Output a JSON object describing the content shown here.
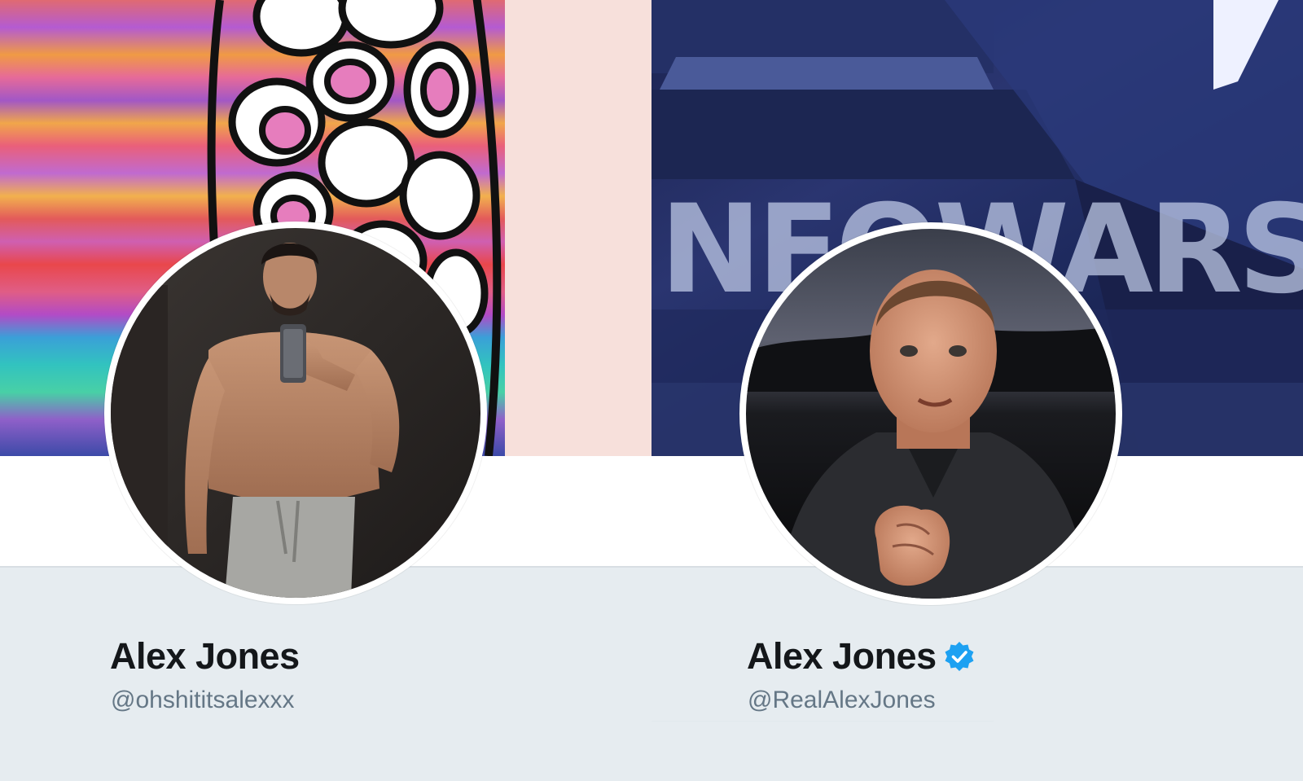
{
  "profiles": [
    {
      "display_name": "Alex Jones",
      "handle": "@ohshititsalexxx",
      "verified": false,
      "banner_icon": "psychedelic-art-banner",
      "avatar_icon": "mirror-selfie-photo"
    },
    {
      "display_name": "Alex Jones",
      "handle": "@RealAlexJones",
      "verified": true,
      "banner_text": "NFOWARS",
      "banner_icon": "news-studio-banner",
      "avatar_icon": "portrait-photo"
    }
  ],
  "colors": {
    "name": "#14171a",
    "handle": "#657786",
    "info_panel": "#e6ecf0",
    "verified_blue": "#1da1f2"
  }
}
